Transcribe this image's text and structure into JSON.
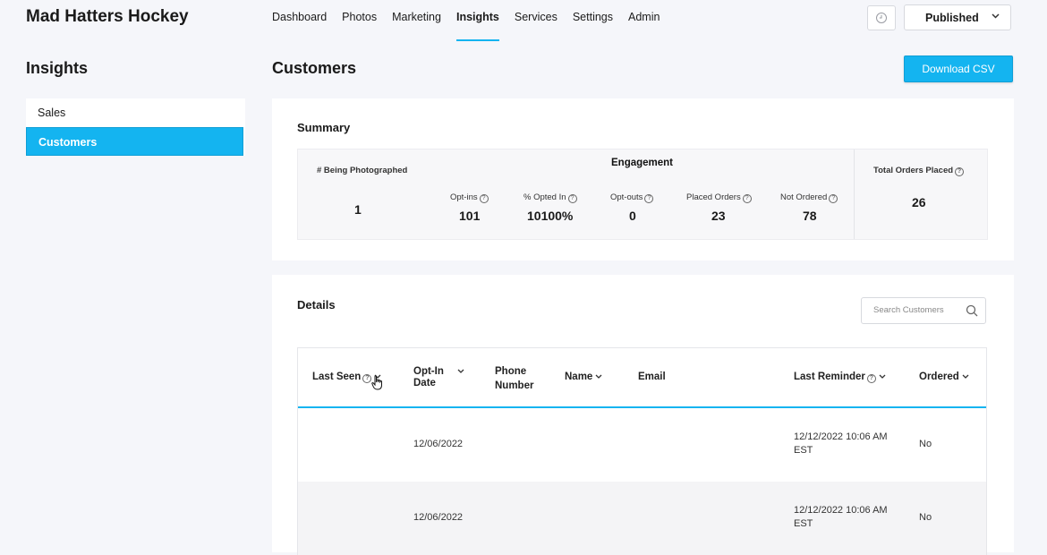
{
  "app": {
    "brand": "Mad Hatters Hockey",
    "nav": [
      {
        "label": "Dashboard"
      },
      {
        "label": "Photos"
      },
      {
        "label": "Marketing"
      },
      {
        "label": "Insights",
        "active": true
      },
      {
        "label": "Services"
      },
      {
        "label": "Settings"
      },
      {
        "label": "Admin"
      }
    ],
    "publish_label": "Published",
    "accent": "#14b4f0"
  },
  "sidebar": {
    "title": "Insights",
    "items": [
      {
        "label": "Sales"
      },
      {
        "label": "Customers",
        "active": true
      }
    ]
  },
  "main": {
    "title": "Customers",
    "download_label": "Download CSV",
    "summary": {
      "title": "Summary",
      "being_photographed": {
        "label": "# Being Photographed",
        "value": "1"
      },
      "engagement_title": "Engagement",
      "metrics": [
        {
          "label": "Opt-ins",
          "value": "101"
        },
        {
          "label": "% Opted In",
          "value": "10100%"
        },
        {
          "label": "Opt-outs",
          "value": "0"
        },
        {
          "label": "Placed Orders",
          "value": "23"
        },
        {
          "label": "Not Ordered",
          "value": "78"
        }
      ],
      "total_orders": {
        "label": "Total Orders Placed",
        "value": "26"
      }
    },
    "details": {
      "title": "Details",
      "search_placeholder": "Search Customers",
      "columns": [
        {
          "label": "Last Seen"
        },
        {
          "label": "Opt-In Date"
        },
        {
          "label": "Phone Number"
        },
        {
          "label": "Name"
        },
        {
          "label": "Email"
        },
        {
          "label": "Last Reminder"
        },
        {
          "label": "Ordered"
        }
      ],
      "rows": [
        {
          "last_seen": "",
          "opt_in_date": "12/06/2022",
          "phone": "",
          "name": "",
          "email": "",
          "last_reminder": "12/12/2022 10:06 AM EST",
          "ordered": "No"
        },
        {
          "last_seen": "",
          "opt_in_date": "12/06/2022",
          "phone": "",
          "name": "",
          "email": "",
          "last_reminder": "12/12/2022 10:06 AM EST",
          "ordered": "No"
        }
      ]
    }
  }
}
